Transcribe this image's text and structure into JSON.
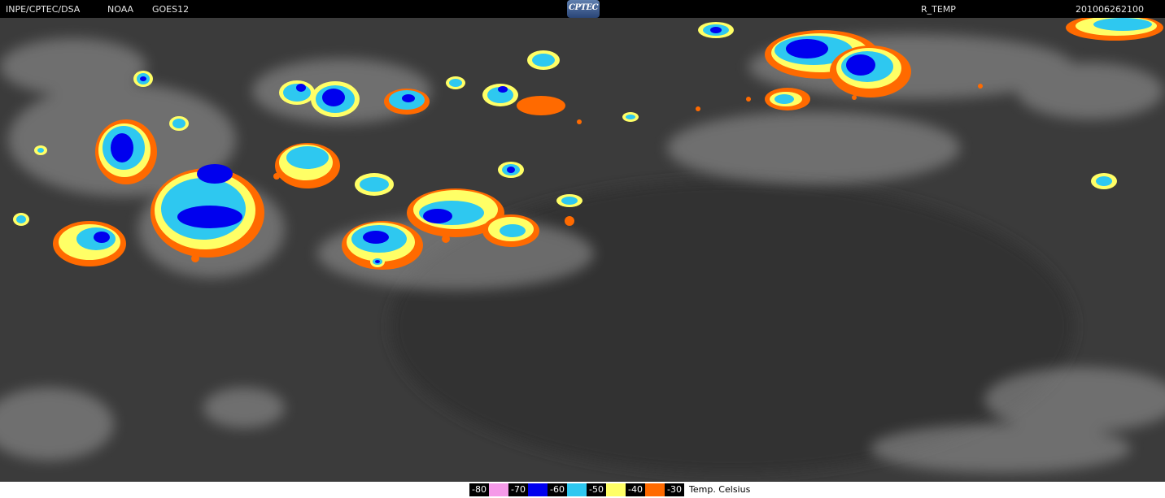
{
  "header": {
    "agency": "INPE/CPTEC/DSA",
    "provider": "NOAA",
    "satellite": "GOES12",
    "product": "R_TEMP",
    "datetime": "201006262100",
    "logo_text": "CPTEC"
  },
  "legend": {
    "unit": "Temp. Celsius",
    "bins": [
      {
        "label": "-80",
        "color": "#f59ae8"
      },
      {
        "label": "-70",
        "color": "#0000ee"
      },
      {
        "label": "-60",
        "color": "#2ec8f0"
      },
      {
        "label": "-50",
        "color": "#ffff66"
      },
      {
        "label": "-40",
        "color": "#ff6a00"
      },
      {
        "label": "-30",
        "color": "#000000"
      }
    ]
  },
  "colors": {
    "background": "#3b3b3b",
    "cloud_gray": "#bdbdbd",
    "orange": "#ff6a00",
    "yellow": "#ffff66",
    "cyan": "#2ec8f0",
    "blue": "#0000ee",
    "pink": "#f59ae8"
  }
}
